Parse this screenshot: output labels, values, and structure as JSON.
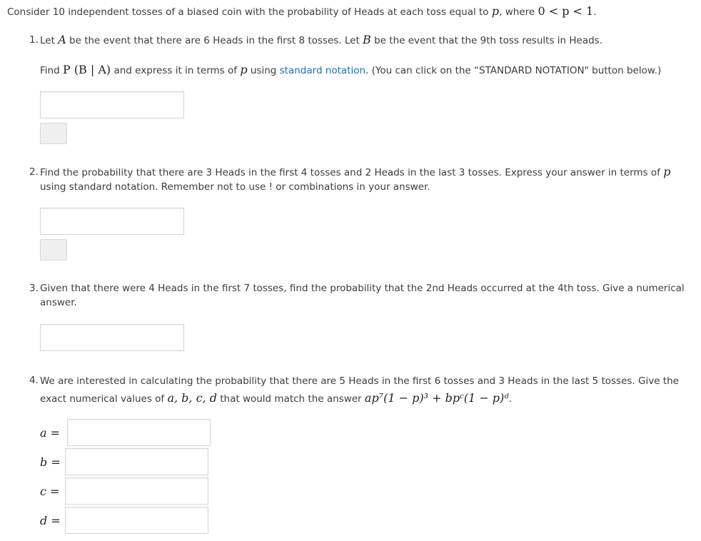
{
  "intro": {
    "text_before": "Consider 10 independent tosses of a biased coin with the probability of Heads at each toss equal to ",
    "var_p": "p",
    "text_mid": ", where ",
    "math": "0 < p < 1",
    "text_end": "."
  },
  "q1": {
    "number": "1.",
    "line1_a": "Let ",
    "var_A": "A",
    "line1_b": " be the event that there are 6 Heads in the first 8 tosses. Let ",
    "var_B": "B",
    "line1_c": " be the event that the 9th toss results in Heads.",
    "find": "Find ",
    "prob_expr": "P (B | A)",
    "after_expr": " and express it in terms of ",
    "var_p": "p",
    "using": " using ",
    "link": "standard notation",
    "tail": ". (You can click on the “STANDARD NOTATION\" button below.)",
    "answer_value": ""
  },
  "q2": {
    "number": "2.",
    "text_a": "Find the probability that there are 3 Heads in the first 4 tosses and 2 Heads in the last 3 tosses. Express your answer in terms of ",
    "var_p": "p",
    "text_b": " using standard notation. Remember not to use ! or combinations in your answer.",
    "answer_value": ""
  },
  "q3": {
    "number": "3.",
    "text": "Given that there were 4 Heads in the first 7 tosses, find the probability that the 2nd Heads occurred at the 4th toss. Give a numerical answer.",
    "answer_value": ""
  },
  "q4": {
    "number": "4.",
    "text_a": "We are interested in calculating the probability that there are 5 Heads in the first 6 tosses and 3 Heads in the last 5 tosses. Give the exact numerical values of ",
    "vars": "a, b, c, d",
    "text_b": " that would match the answer ",
    "formula": "ap⁷(1 − p)³ + bpᶜ(1 − p)ᵈ",
    "text_c": ".",
    "labels": {
      "a": "a =",
      "b": "b =",
      "c": "c =",
      "d": "d ="
    },
    "values": {
      "a": "",
      "b": "",
      "c": "",
      "d": ""
    }
  }
}
